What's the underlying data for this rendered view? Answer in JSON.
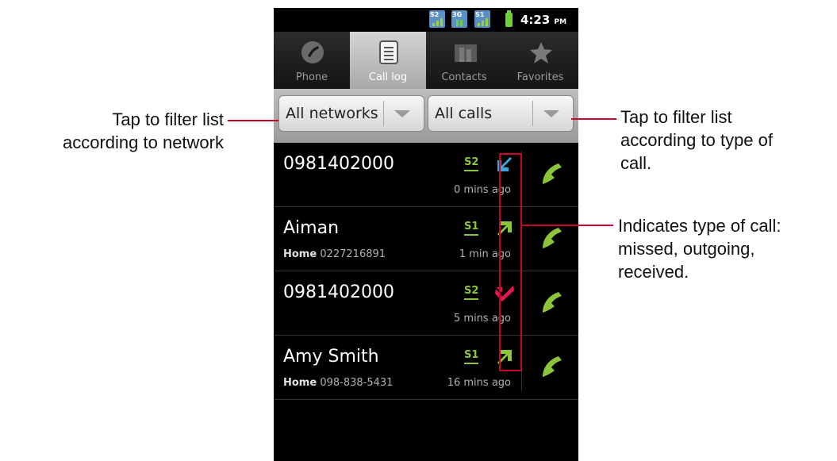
{
  "status": {
    "networks": [
      "S2",
      "3G",
      "S1"
    ],
    "time": "4:23",
    "ampm": "PM"
  },
  "tabs": [
    {
      "label": "Phone",
      "icon": "phone-icon"
    },
    {
      "label": "Call log",
      "icon": "call-log-icon",
      "active": true
    },
    {
      "label": "Contacts",
      "icon": "contacts-icon"
    },
    {
      "label": "Favorites",
      "icon": "star-icon"
    }
  ],
  "filters": {
    "network": "All networks",
    "calls": "All calls"
  },
  "calls": [
    {
      "name": "0981402000",
      "label": "",
      "number": "",
      "network": "S2",
      "type": "received",
      "age": "0 mins ago"
    },
    {
      "name": "Aiman",
      "label": "Home",
      "number": "0227216891",
      "network": "S1",
      "type": "outgoing",
      "age": "1 min ago"
    },
    {
      "name": "0981402000",
      "label": "",
      "number": "",
      "network": "S2",
      "type": "missed",
      "age": "5 mins ago"
    },
    {
      "name": "Amy Smith",
      "label": "Home",
      "number": "098-838-5431",
      "network": "S1",
      "type": "outgoing",
      "age": "16 mins ago"
    }
  ],
  "annotations": {
    "left": "Tap to filter list according to network",
    "left_line1": "Tap to filter list",
    "left_line2": "according to network",
    "right1_line1": "Tap to filter list",
    "right1_line2": "according to type of",
    "right1_line3": "call.",
    "right2_line1": "Indicates type of call:",
    "right2_line2": "missed, outgoing,",
    "right2_line3": "received."
  },
  "colors": {
    "highlight": "#c8002c",
    "call_green": "#8cc43a",
    "missed": "#e8174f",
    "received": "#3aa7e0"
  }
}
